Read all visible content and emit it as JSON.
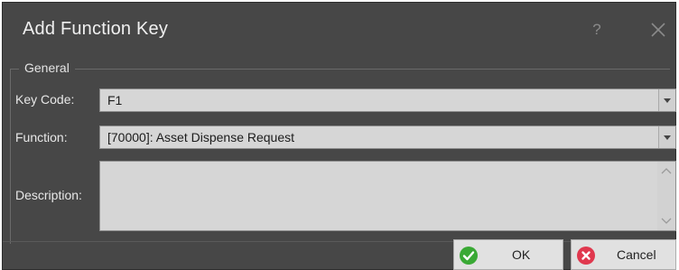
{
  "window": {
    "title": "Add Function Key",
    "help_symbol": "?"
  },
  "group": {
    "label": "General"
  },
  "key_code": {
    "label": "Key Code:",
    "value": "F1"
  },
  "function": {
    "label": "Function:",
    "value": "[70000]: Asset Dispense Request"
  },
  "description": {
    "label": "Description:",
    "value": ""
  },
  "buttons": {
    "ok_label": "OK",
    "ok_icon": "check-circle-icon",
    "cancel_label": "Cancel",
    "cancel_icon": "x-circle-icon"
  },
  "colors": {
    "dialog_bg": "#474747",
    "field_bg": "#d6d6d6",
    "ok_green": "#3aa935",
    "cancel_red": "#e0384e"
  }
}
